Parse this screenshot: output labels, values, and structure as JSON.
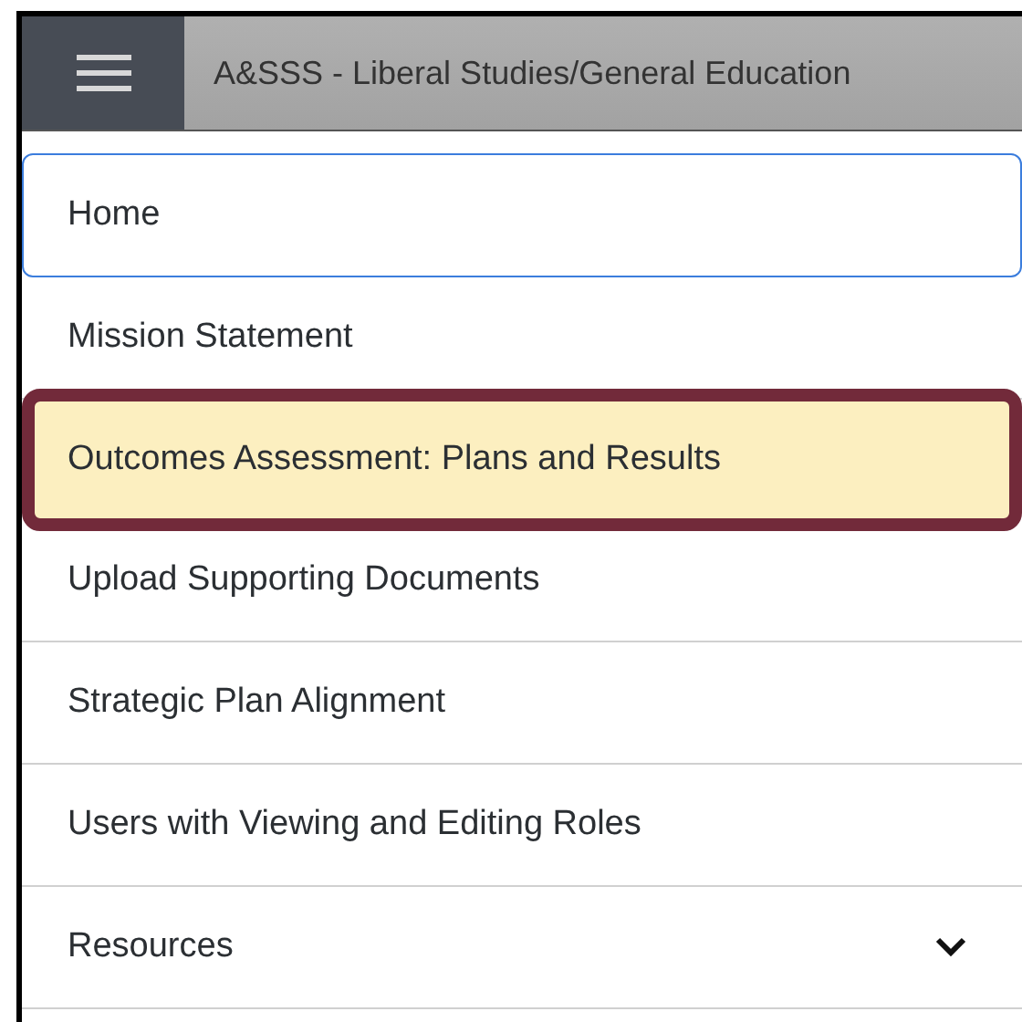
{
  "header": {
    "title": "A&SSS - Liberal Studies/General Education"
  },
  "menu": [
    {
      "label": "Home",
      "kind": "link",
      "selected": false,
      "focused": true
    },
    {
      "label": "Mission Statement",
      "kind": "link",
      "selected": false,
      "focused": false
    },
    {
      "label": "Outcomes Assessment: Plans and Results",
      "kind": "link",
      "selected": true,
      "focused": false
    },
    {
      "label": "Upload Supporting Documents",
      "kind": "link",
      "selected": false,
      "focused": false
    },
    {
      "label": "Strategic Plan Alignment",
      "kind": "link",
      "selected": false,
      "focused": false
    },
    {
      "label": "Users with Viewing and Editing Roles",
      "kind": "link",
      "selected": false,
      "focused": false
    },
    {
      "label": "Resources",
      "kind": "submenu",
      "selected": false,
      "focused": false,
      "expanded": false
    }
  ]
}
